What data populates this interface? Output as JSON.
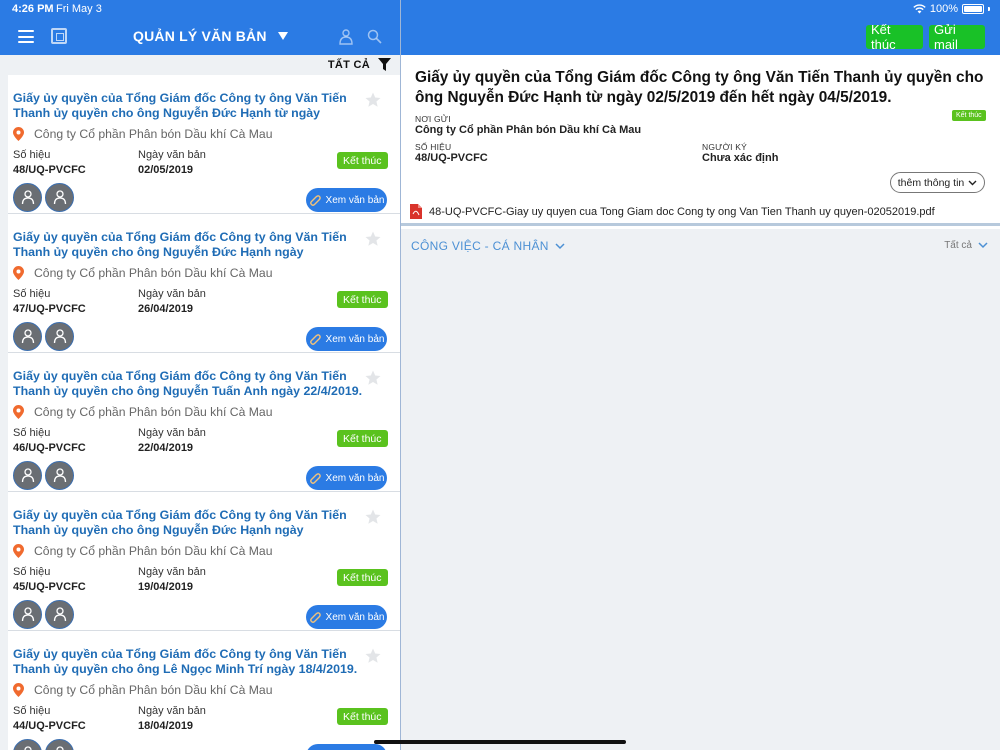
{
  "status_bar": {
    "time": "4:26 PM",
    "date": "Fri May 3",
    "battery": "100%"
  },
  "header": {
    "title": "QUẢN LÝ VĂN BẢN",
    "finish_button": "Kết thúc",
    "send_mail_button": "Gửi mail"
  },
  "filter": {
    "label": "TẤT CẢ"
  },
  "labels": {
    "so_hieu": "Số hiệu",
    "ngay_van_ban": "Ngày văn bản",
    "view_button": "Xem văn bản"
  },
  "documents": [
    {
      "title": "Giấy ủy quyền của Tổng Giám đốc Công ty ông Văn Tiến Thanh ủy quyền cho ông Nguyễn Đức Hạnh từ ngày 02/5/2019 đến...",
      "organization": "Công ty Cổ phần Phân bón Dầu khí Cà Mau",
      "so_hieu": "48/UQ-PVCFC",
      "date": "02/05/2019",
      "status": "Kết thúc"
    },
    {
      "title": "Giấy ủy quyền của Tổng Giám đốc Công ty ông Văn Tiến Thanh ủy quyền cho ông Nguyễn Đức Hạnh ngày 26/4/2019.",
      "organization": "Công ty Cổ phần Phân bón Dầu khí Cà Mau",
      "so_hieu": "47/UQ-PVCFC",
      "date": "26/04/2019",
      "status": "Kết thúc"
    },
    {
      "title": "Giấy ủy quyền của Tổng Giám đốc Công ty ông Văn Tiến Thanh ủy quyền cho ông Nguyễn Tuấn Anh ngày 22/4/2019.",
      "organization": "Công ty Cổ phần Phân bón Dầu khí Cà Mau",
      "so_hieu": "46/UQ-PVCFC",
      "date": "22/04/2019",
      "status": "Kết thúc"
    },
    {
      "title": "Giấy ủy quyền của Tổng Giám đốc Công ty ông Văn Tiến Thanh ủy quyền cho ông Nguyễn Đức Hạnh ngày 19/4/2019.",
      "organization": "Công ty Cổ phần Phân bón Dầu khí Cà Mau",
      "so_hieu": "45/UQ-PVCFC",
      "date": "19/04/2019",
      "status": "Kết thúc"
    },
    {
      "title": "Giấy ủy quyền của Tổng Giám đốc Công ty ông Văn Tiến Thanh ủy quyền cho ông Lê Ngọc Minh Trí ngày 18/4/2019.",
      "organization": "Công ty Cổ phần Phân bón Dầu khí Cà Mau",
      "so_hieu": "44/UQ-PVCFC",
      "date": "18/04/2019",
      "status": "Kết thúc"
    }
  ],
  "detail": {
    "title": "Giấy ủy quyền của Tổng Giám đốc Công ty ông Văn Tiến Thanh ủy quyền cho ông Nguyễn Đức Hạnh từ ngày 02/5/2019 đến hết ngày 04/5/2019.",
    "sender_label": "NƠI GỬI",
    "sender": "Công ty Cổ phần Phân bón Dầu khí Cà Mau",
    "status": "Kết thúc",
    "so_hieu_label": "SỐ HIỆU",
    "so_hieu": "48/UQ-PVCFC",
    "signer_label": "NGƯỜI KÝ",
    "signer": "Chưa xác định",
    "more_button": "thêm thông tin",
    "attachment": "48-UQ-PVCFC-Giay uy quyen cua Tong Giam doc Cong ty ong Van Tien Thanh uy quyen-02052019.pdf"
  },
  "work": {
    "title": "CÔNG VIỆC - CÁ NHÂN",
    "filter": "Tất cả"
  },
  "colors": {
    "primary": "#2b7be4",
    "title_link": "#1f6cb5",
    "status_green": "#5ac21e",
    "button_green": "#19c127",
    "pin_orange": "#f06a2e"
  }
}
